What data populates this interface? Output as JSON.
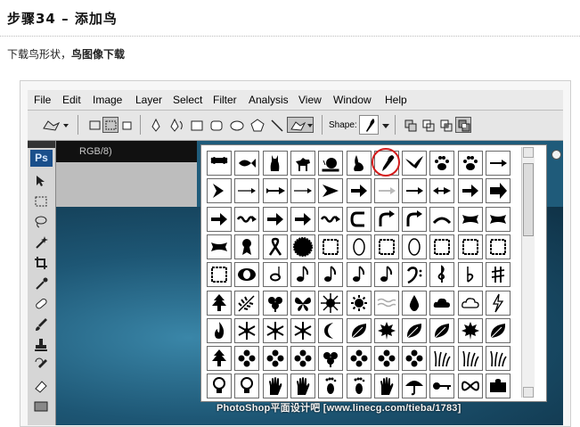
{
  "article": {
    "heading": "步骤34 – 添加鸟",
    "instruction_prefix": "下载鸟形状，",
    "instruction_bold": "鸟图像下载"
  },
  "photoshop": {
    "menu": [
      "File",
      "Edit",
      "Image",
      "Layer",
      "Select",
      "Filter",
      "Analysis",
      "View",
      "Window",
      "Help"
    ],
    "options_bar": {
      "shape_label": "Shape:",
      "selected_shape": "bird-shape"
    },
    "document": {
      "title_tab": "RGB/8)"
    },
    "toolbox": {
      "logo": "Ps",
      "tools": [
        "move-tool",
        "marquee-tool",
        "lasso-tool",
        "magic-wand-tool",
        "crop-tool",
        "eyedropper-tool",
        "healing-brush-tool",
        "brush-tool",
        "clone-stamp-tool",
        "history-brush-tool",
        "eraser-tool",
        "gradient-tool"
      ]
    },
    "shape_picker": {
      "selected_index": 6,
      "rows": [
        [
          "bone",
          "fish",
          "cat",
          "dog",
          "snail",
          "rabbit",
          "bird",
          "flying-bird",
          "paw-print",
          "paw-print-2",
          "arrow-feather"
        ],
        [
          "chevron-arrow",
          "thin-arrow",
          "fletched-arrow",
          "thin-arrow-2",
          "notched-arrow",
          "bold-arrow",
          "light-arrow",
          "arrow-3",
          "double-arrow",
          "fat-arrow",
          "block-arrow"
        ],
        [
          "right-arrow",
          "wavy-arrow",
          "right-arrow-2",
          "right-arrow-3",
          "twisted-arrow",
          "u-turn-arrow",
          "curved-arrow",
          "turn-arrow",
          "curve-up",
          "banner-1",
          "banner-2"
        ],
        [
          "banner-3",
          "ribbon-award",
          "ribbon-loop",
          "seal",
          "frame-rect",
          "frame-oval",
          "frame-rect-2",
          "frame-oval-2",
          "frame-rect-3",
          "frame-rect-4",
          "frame-rect-5"
        ],
        [
          "frame-rough",
          "oval-ring",
          "whole-note",
          "quarter-note",
          "eighth-note",
          "beamed-notes",
          "sixteenth-note",
          "bass-clef",
          "treble-clef",
          "flat-sign",
          "sharp-sign"
        ],
        [
          "tree",
          "fern",
          "clover",
          "butterfly",
          "sun-burst",
          "sun",
          "waves",
          "raindrop",
          "cloud",
          "cloud-2",
          "lightning"
        ],
        [
          "fire",
          "snowflake",
          "snowflake-2",
          "snowflake-3",
          "crescent-moon",
          "leaf",
          "maple-leaf",
          "leaf-2",
          "leaf-3",
          "maple-leaf-2",
          "leaf-4"
        ],
        [
          "tree-2",
          "flower",
          "flower-2",
          "floral",
          "four-leaf-clover",
          "flower-3",
          "flower-4",
          "flower-5",
          "grass",
          "grass-2",
          "grass-3"
        ],
        [
          "lightbulb",
          "lightbulb-2",
          "hand",
          "hand-2",
          "footprint",
          "footprint-2",
          "hand-3",
          "umbrella",
          "key",
          "bow",
          "puzzle-piece"
        ]
      ]
    },
    "watermark": "PhotoShop平面设计吧 [www.linecg.com/tieba/1783]"
  }
}
